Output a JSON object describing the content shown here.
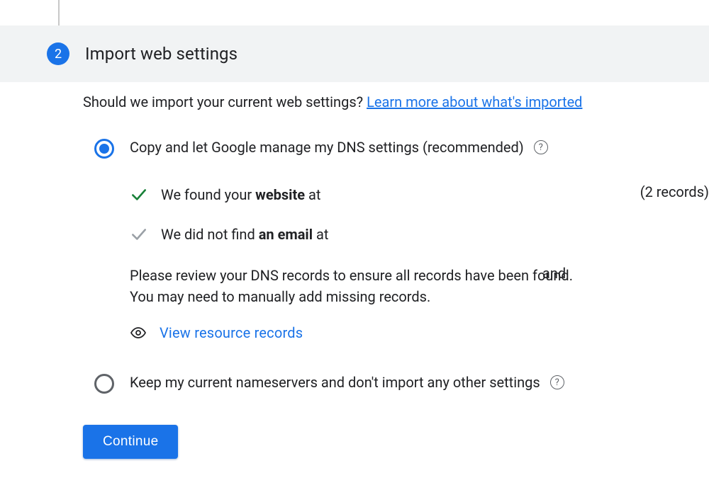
{
  "step": {
    "number": "2",
    "title": "Import web settings"
  },
  "prompt": "Should we import your current web settings? ",
  "learn_more": "Learn more about what's imported",
  "option1": {
    "label": "Copy and let Google manage my DNS settings (recommended)"
  },
  "found": {
    "website_prefix": "We found your ",
    "website_bold": "website",
    "website_suffix": " at",
    "and": "and",
    "records_count": "(2 records)",
    "email_prefix": "We did not find ",
    "email_bold": "an email",
    "email_suffix": " at"
  },
  "review_note_line1": "Please review your DNS records to ensure all records have been found.",
  "review_note_line2": "You may need to manually add missing records.",
  "view_records": "View resource records",
  "option2": {
    "label": "Keep my current nameservers and don't import any other settings"
  },
  "continue": "Continue"
}
